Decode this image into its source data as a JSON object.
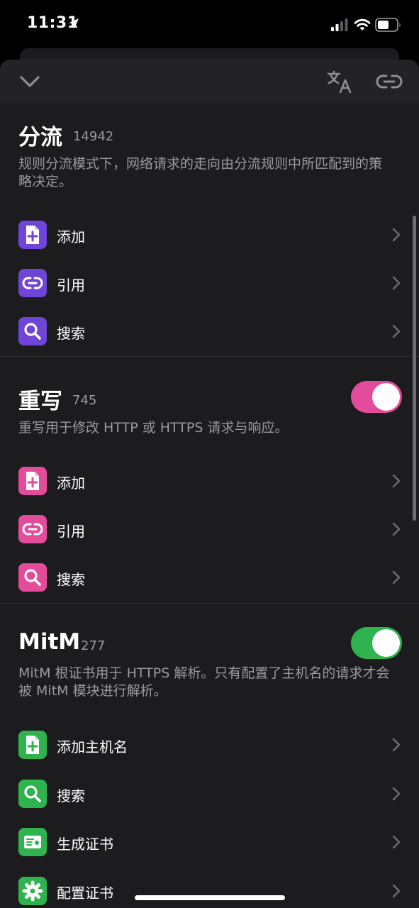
{
  "status_bar": {
    "time": "11:31"
  },
  "colors": {
    "purple": "#6f45d8",
    "pink": "#e34b9b",
    "green": "#2fb34f"
  },
  "sections": [
    {
      "title": "分流",
      "count": "14942",
      "description": "规则分流模式下，网络请求的走向由分流规则中所匹配到的策略决定。",
      "items": [
        {
          "label": "添加",
          "icon": "add-file-icon"
        },
        {
          "label": "引用",
          "icon": "link-icon"
        },
        {
          "label": "搜索",
          "icon": "search-icon"
        }
      ]
    },
    {
      "title": "重写",
      "count": "745",
      "enabled": true,
      "description": "重写用于修改 HTTP 或 HTTPS 请求与响应。",
      "items": [
        {
          "label": "添加",
          "icon": "add-file-icon"
        },
        {
          "label": "引用",
          "icon": "link-icon"
        },
        {
          "label": "搜索",
          "icon": "search-icon"
        }
      ]
    },
    {
      "title": "MitM",
      "count": "277",
      "enabled": true,
      "description": "MitM 根证书用于 HTTPS 解析。只有配置了主机名的请求才会被 MitM 模块进行解析。",
      "items": [
        {
          "label": "添加主机名",
          "icon": "add-file-icon"
        },
        {
          "label": "搜索",
          "icon": "search-icon"
        },
        {
          "label": "生成证书",
          "icon": "certificate-icon"
        },
        {
          "label": "配置证书",
          "icon": "gear-icon"
        }
      ]
    }
  ]
}
